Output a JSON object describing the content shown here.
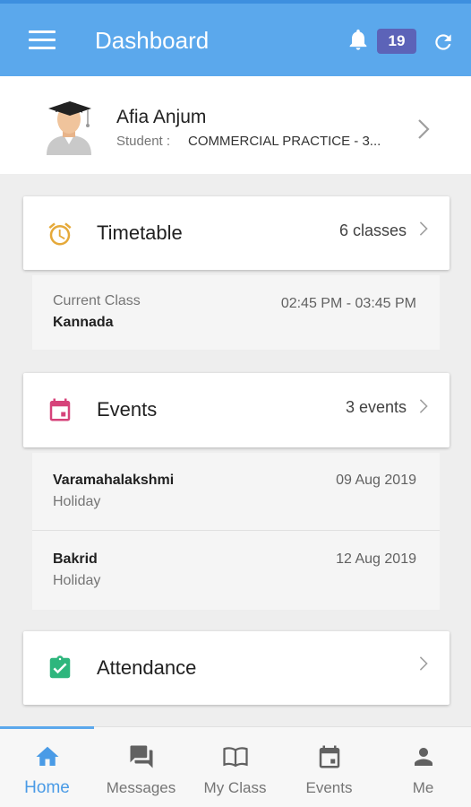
{
  "appbar": {
    "title": "Dashboard",
    "notification_count": "19"
  },
  "profile": {
    "name": "Afia Anjum",
    "role": "Student :",
    "course": "COMMERCIAL PRACTICE - 3..."
  },
  "timetable": {
    "title": "Timetable",
    "count": "6 classes",
    "current_label": "Current Class",
    "current_value": "Kannada",
    "time_range": "02:45 PM - 03:45 PM"
  },
  "events": {
    "title": "Events",
    "count": "3 events",
    "items": [
      {
        "name": "Varamahalakshmi",
        "type": "Holiday",
        "date": "09 Aug 2019"
      },
      {
        "name": "Bakrid",
        "type": "Holiday",
        "date": "12 Aug 2019"
      }
    ]
  },
  "attendance": {
    "title": "Attendance"
  },
  "bottom_nav": {
    "items": [
      {
        "label": "Home",
        "icon": "home-icon"
      },
      {
        "label": "Messages",
        "icon": "messages-icon"
      },
      {
        "label": "My Class",
        "icon": "book-icon"
      },
      {
        "label": "Events",
        "icon": "calendar-icon"
      },
      {
        "label": "Me",
        "icon": "person-icon"
      }
    ],
    "active": "Home"
  },
  "colors": {
    "appbar": "#5ba8ec",
    "badge": "#5c63b8",
    "timetable_icon": "#e5a93a",
    "events_icon": "#d6437a",
    "attendance_icon": "#2eb67d",
    "nav_active": "#4a9be6"
  }
}
